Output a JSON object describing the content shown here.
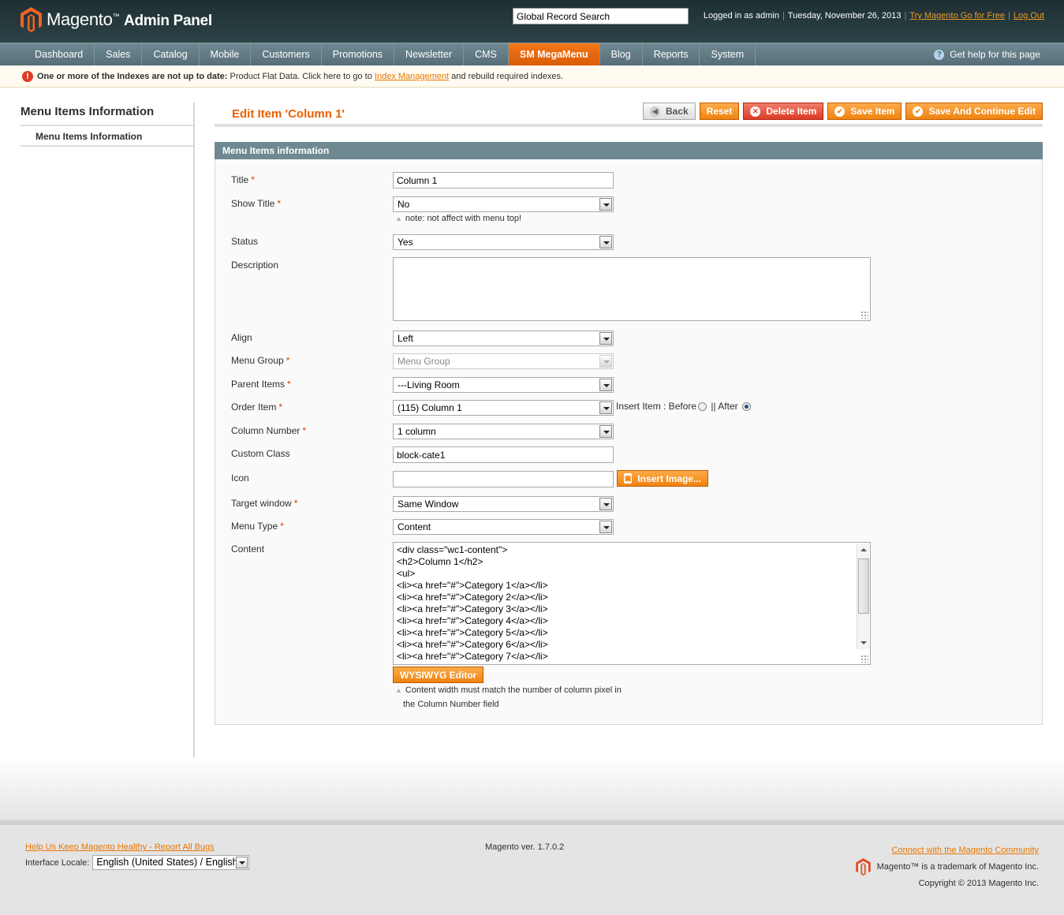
{
  "header": {
    "logo_text": "Magento",
    "logo_tm": "™",
    "logo_sub": "Admin Panel",
    "search_value": "Global Record Search",
    "logged_in": "Logged in as admin",
    "date": "Tuesday, November 26, 2013",
    "try_link": "Try Magento Go for Free",
    "logout": "Log Out"
  },
  "nav": {
    "items": [
      "Dashboard",
      "Sales",
      "Catalog",
      "Mobile",
      "Customers",
      "Promotions",
      "Newsletter",
      "CMS",
      "SM MegaMenu",
      "Blog",
      "Reports",
      "System"
    ],
    "active": "SM MegaMenu",
    "help": "Get help for this page"
  },
  "notice": {
    "bold": "One or more of the Indexes are not up to date:",
    "text": "Product Flat Data. Click here to go to",
    "link": "Index Management",
    "after": "and rebuild required indexes."
  },
  "sidebar": {
    "title": "Menu Items Information",
    "item": "Menu Items Information"
  },
  "page": {
    "title": "Edit Item 'Column 1'",
    "buttons": {
      "back": "Back",
      "reset": "Reset",
      "delete": "Delete Item",
      "save": "Save Item",
      "save_continue": "Save And Continue Edit"
    }
  },
  "form": {
    "section_title": "Menu Items information",
    "title_label": "Title",
    "title_value": "Column 1",
    "show_title_label": "Show Title",
    "show_title_value": "No",
    "show_title_note": "note: not affect with menu top!",
    "status_label": "Status",
    "status_value": "Yes",
    "description_label": "Description",
    "align_label": "Align",
    "align_value": "Left",
    "menu_group_label": "Menu Group",
    "menu_group_value": "Menu Group",
    "parent_label": "Parent Items",
    "parent_value": "---Living Room",
    "order_label": "Order Item",
    "order_value": "(115) Column 1",
    "insert_label": "Insert Item : Before",
    "after_label": "|| After",
    "column_number_label": "Column Number",
    "column_number_value": "1 column",
    "custom_class_label": "Custom Class",
    "custom_class_value": "block-cate1",
    "icon_label": "Icon",
    "insert_image": "Insert Image...",
    "target_label": "Target window",
    "target_value": "Same Window",
    "menu_type_label": "Menu Type",
    "menu_type_value": "Content",
    "content_label": "Content",
    "content_lines": [
      "<div class=\"wc1-content\">",
      "<h2>Column 1</h2>",
      "<ul>",
      "<li><a href=\"#\">Category 1</a></li>",
      "<li><a href=\"#\">Category 2</a></li>",
      "<li><a href=\"#\">Category 3</a></li>",
      "<li><a href=\"#\">Category 4</a></li>",
      "<li><a href=\"#\">Category 5</a></li>",
      "<li><a href=\"#\">Category 6</a></li>",
      "<li><a href=\"#\">Category 7</a></li>"
    ],
    "wysiwyg": "WYSIWYG Editor",
    "content_note_1": "Content width must match the number of column pixel in",
    "content_note_2": "the Column Number field"
  },
  "footer": {
    "help_link": "Help Us Keep Magento Healthy - Report All Bugs",
    "locale_label": "Interface Locale:",
    "locale_value": "English (United States) / English",
    "version": "Magento ver. 1.7.0.2",
    "community": "Connect with the Magento Community",
    "trademark": "Magento™ is a trademark of Magento Inc.",
    "copyright": "Copyright © 2013 Magento Inc."
  },
  "colors": {
    "accent": "#f08310",
    "title": "#eb5e00",
    "header": "#1e2f33",
    "nav": "#6f8993"
  }
}
